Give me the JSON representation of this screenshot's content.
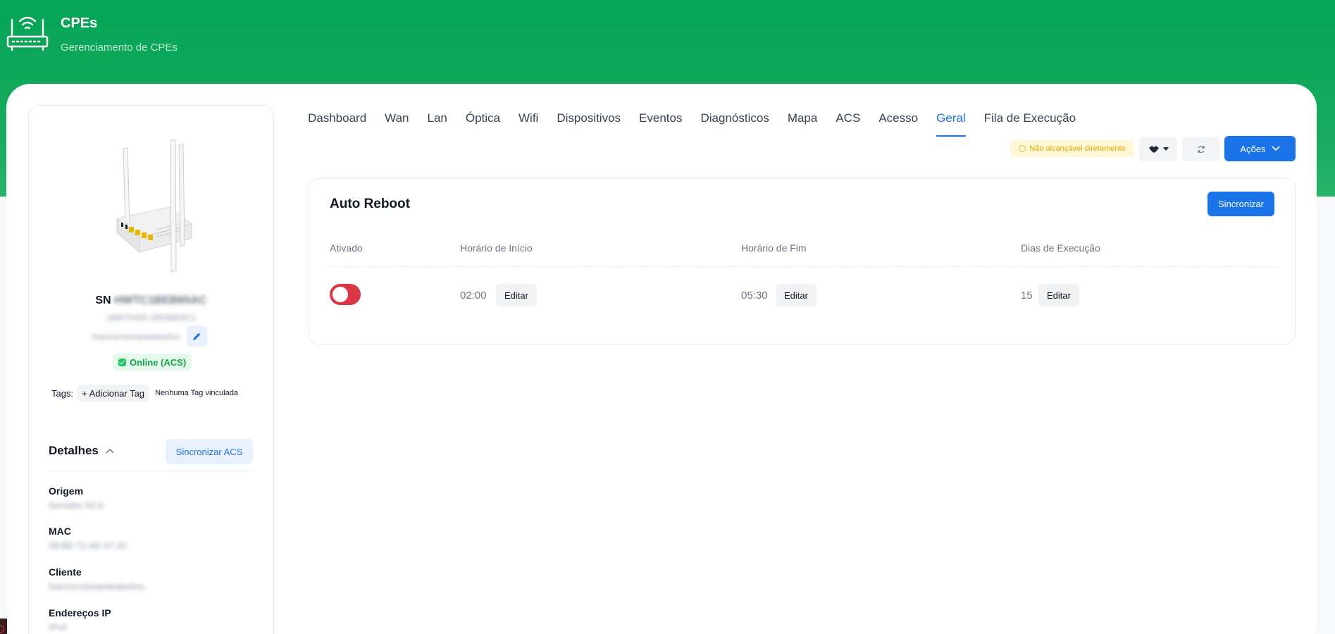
{
  "header": {
    "title": "CPEs",
    "subtitle": "Gerenciamento de CPEs",
    "icon": "router-wifi-icon"
  },
  "device": {
    "sn_prefix": "SN",
    "serial": "HWTC1BEB65AC",
    "secondary_id": "(48575443 1BEB65AC)",
    "description": "franciscolonantedaolivo",
    "status": "Online (ACS)",
    "tags_label": "Tags:",
    "add_tag": "+ Adicionar Tag",
    "no_tags": "Nenhuma Tag vinculada"
  },
  "details": {
    "title": "Detalhes",
    "sync_label": "Sincronizar ACS",
    "items": [
      {
        "label": "Origem",
        "value": "Servidor ACS"
      },
      {
        "label": "MAC",
        "value": "58:BE:72:AE:47:20"
      },
      {
        "label": "Cliente",
        "value": "franciscolonantedaolivo"
      },
      {
        "label": "Endereços IP",
        "value": "IPv4"
      }
    ]
  },
  "tabs": [
    {
      "label": "Dashboard",
      "active": false
    },
    {
      "label": "Wan",
      "active": false
    },
    {
      "label": "Lan",
      "active": false
    },
    {
      "label": "Óptica",
      "active": false
    },
    {
      "label": "Wifi",
      "active": false
    },
    {
      "label": "Dispositivos",
      "active": false
    },
    {
      "label": "Eventos",
      "active": false
    },
    {
      "label": "Diagnósticos",
      "active": false
    },
    {
      "label": "Mapa",
      "active": false
    },
    {
      "label": "ACS",
      "active": false
    },
    {
      "label": "Acesso",
      "active": false
    },
    {
      "label": "Geral",
      "active": true
    },
    {
      "label": "Fila de Execução",
      "active": false
    }
  ],
  "toolbar": {
    "reachability": "Não alcançável diretamente",
    "actions_label": "Ações"
  },
  "auto_reboot": {
    "title": "Auto Reboot",
    "sync_label": "Sincronizar",
    "columns": [
      "Ativado",
      "Horário de Início",
      "Horário de Fim",
      "Dias de Execução"
    ],
    "enabled": false,
    "start_time": "02:00",
    "end_time": "05:30",
    "days": "15",
    "edit_label": "Editar"
  },
  "colors": {
    "brand_green": "#05a457",
    "primary_blue": "#1a73e8",
    "toggle_red": "#dc3545"
  }
}
